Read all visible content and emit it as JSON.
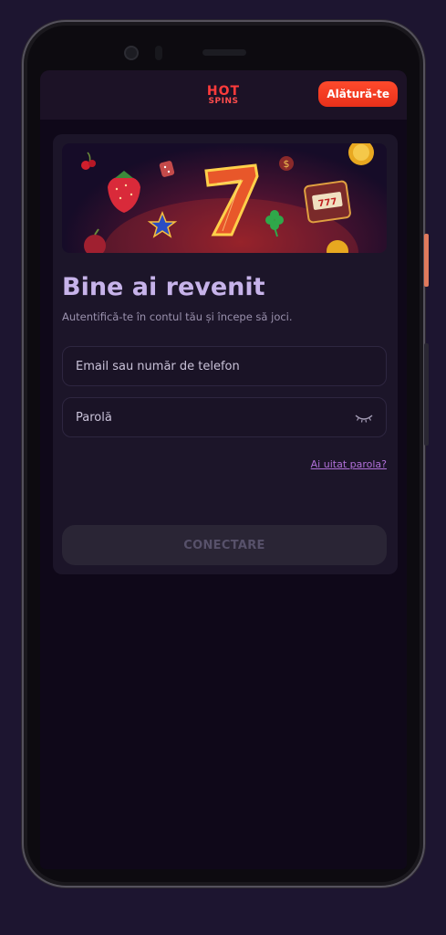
{
  "header": {
    "logo_line1": "HOT",
    "logo_line2": "SPINS",
    "join_label": "Alătură-te"
  },
  "login": {
    "title": "Bine ai revenit",
    "subtitle": "Autentifică-te în contul tău și începe să joci.",
    "email_placeholder": "Email sau număr de telefon",
    "password_placeholder": "Parolă",
    "forgot_label": "Ai uitat parola?",
    "submit_label": "CONECTARE"
  },
  "banner": {
    "icons": [
      "cherry-icon",
      "strawberry-icon",
      "dice-icon",
      "seven-icon",
      "dollar-icon",
      "coin-icon",
      "slot-machine-icon",
      "star-icon",
      "clover-icon"
    ]
  },
  "colors": {
    "accent": "#ff3b1f",
    "title": "#c7b3ea",
    "link": "#b070d8",
    "background": "#0f0819"
  }
}
